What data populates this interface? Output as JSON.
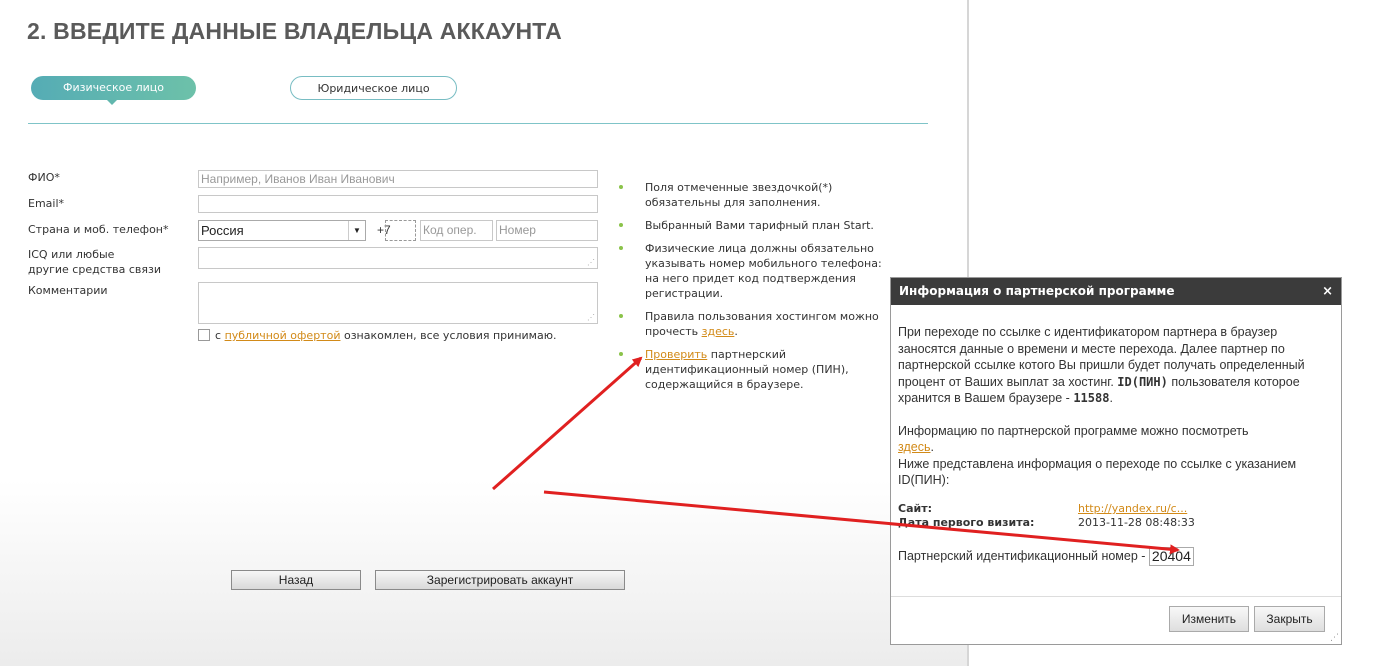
{
  "page": {
    "title": "2. ВВЕДИТЕ ДАННЫЕ ВЛАДЕЛЬЦА АККАУНТА",
    "tabs": [
      {
        "label": "Физическое лицо",
        "active": true
      },
      {
        "label": "Юридическое лицо",
        "active": false
      }
    ]
  },
  "form": {
    "fio_label": "ФИО*",
    "fio_placeholder": "Например, Иванов Иван Иванович",
    "email_label": "Email*",
    "phone_label": "Страна и моб. телефон*",
    "country_value": "Россия",
    "phone_prefix": "+7",
    "code_placeholder": "Код опер.",
    "number_placeholder": "Номер",
    "icq_label_line1": "ICQ или любые",
    "icq_label_line2": "другие средства связи",
    "comments_label": "Комментарии",
    "agree_prefix": "с",
    "agree_link": "публичной офертой",
    "agree_suffix": "ознакомлен, все условия принимаю.",
    "back_button": "Назад",
    "register_button": "Зарегистрировать аккаунт"
  },
  "notes": [
    {
      "text": "Поля отмеченные звездочкой(*) обязательны для заполнения."
    },
    {
      "text": "Выбранный Вами тарифный план Start."
    },
    {
      "text": "Физические лица должны обязательно указывать номер мобильного телефона: на него придет код подтверждения регистрации."
    },
    {
      "text_before": "Правила пользования хостингом можно прочесть ",
      "link": "здесь",
      "text_after": "."
    },
    {
      "link": "Проверить",
      "text_after": " партнерский идентификационный номер (ПИН), содержащийся в браузере."
    }
  ],
  "dialog": {
    "title": "Информация о партнерской программе",
    "close_icon": "×",
    "para1_text": "При переходе по ссылке с идентификатором партнера в браузер заносятся данные о времени и месте перехода. Далее партнер по партнерской ссылке котого Вы пришли будет получать определенный процент от Ваших выплат за хостинг.",
    "para1_id_label": "ID(ПИН)",
    "para1_text2": "пользователя которое хранится в Вашем браузере -",
    "para1_id_value": "11588",
    "para2_text": "Информацию по партнерской программе можно посмотреть",
    "para2_link": "здесь",
    "para3_text": "Ниже представлена информация о переходе по ссылке с указанием ID(ПИН):",
    "site_label": "Сайт:",
    "site_value": "http://yandex.ru/c...",
    "first_visit_label": "Дата первого визита:",
    "first_visit_value": "2013-11-28 08:48:33",
    "pin_label": "Партнерский идентификационный номер -",
    "pin_value": "20404",
    "change_button": "Изменить",
    "close_button": "Закрыть"
  },
  "annotation_color": "#e02020"
}
